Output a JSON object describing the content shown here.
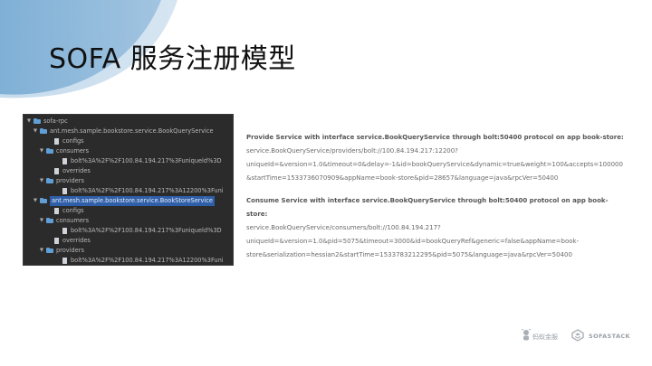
{
  "slide": {
    "title": "SOFA 服务注册模型"
  },
  "tree": {
    "rows": [
      "sofa-rpc",
      "ant.mesh.sample.bookstore.service.BookQueryService",
      "configs",
      "consumers",
      "bolt%3A%2F%2F100.84.194.217%3Funiqueld%3D",
      "overrides",
      "providers",
      "bolt%3A%2F%2F100.84.194.217%3A12200%3Funi",
      "ant.mesh.sample.bookstore.service.BookStoreService",
      "configs",
      "consumers",
      "bolt%3A%2F%2F100.84.194.217%3Funiqueld%3D",
      "overrides",
      "providers",
      "bolt%3A%2F%2F100.84.194.217%3A12200%3Funi"
    ]
  },
  "log": {
    "lines": [
      "Provide Service with interface service.BookQueryService through bolt:50400 protocol on app book-store:",
      "service.BookQueryService/providers/bolt://100.84.194.217:12200?",
      "uniqueId=&version=1.0&timeout=0&delay=-1&id=bookQueryService&dynamic=true&weight=100&accepts=100000",
      "&startTime=1533736070909&appName=book-store&pid=28657&language=java&rpcVer=50400",
      "Consume Service with interface service.BookQueryService through bolt:50400 protocol on app book-",
      "store:",
      "service.BookQueryService/consumers/bolt://100.84.194.217?",
      "uniqueId=&version=1.0&pid=5075&timeout=3000&id=bookQueryRef&generic=false&appName=book-",
      "store&serialization=hessian2&startTime=1533783212295&pid=5075&language=java&rpcVer=50400"
    ]
  },
  "footer": {
    "ant_logo_text": "蚂蚁金服",
    "sofa_logo_text": "SOFASTACK"
  },
  "colors": {
    "tree_bg": "#2b2b2b",
    "selection": "#2f5fa8",
    "folder": "#5f9fd6",
    "title": "#111111",
    "log_text": "#6a6a6a"
  }
}
